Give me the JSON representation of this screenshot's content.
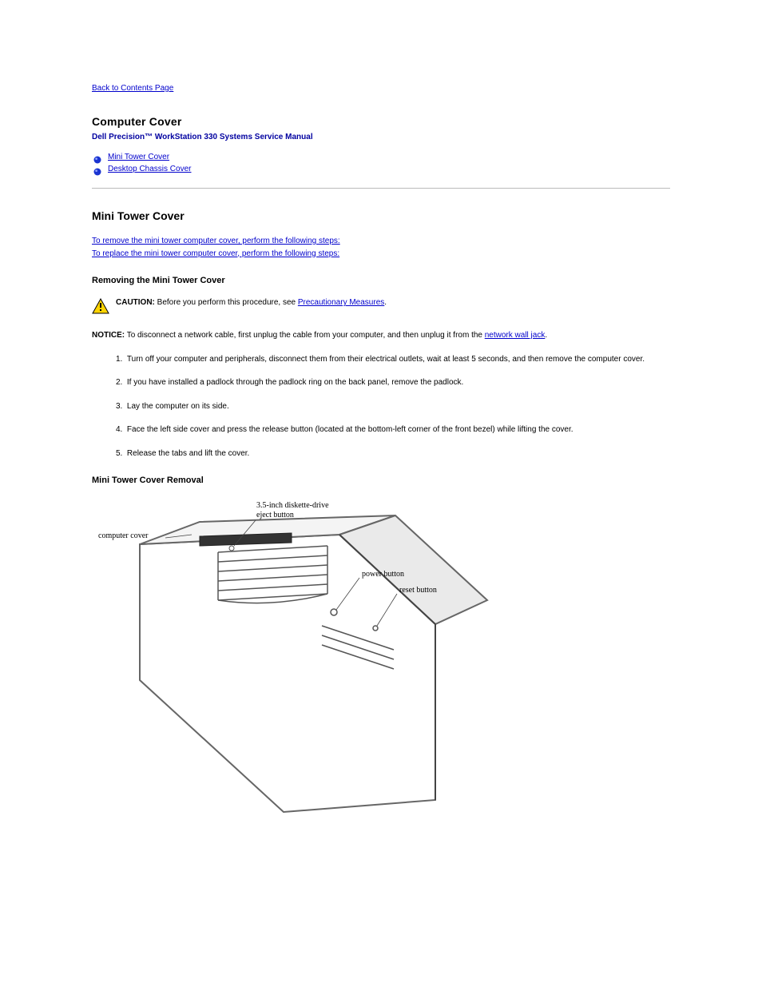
{
  "nav": {
    "back_label": "Back to Contents Page"
  },
  "title": "Computer Cover",
  "subtitle": "Dell Precision™ WorkStation 330 Systems Service Manual",
  "toc": [
    {
      "label": "Mini Tower Cover"
    },
    {
      "label": "Desktop Chassis Cover"
    }
  ],
  "section_heading": "Mini Tower Cover",
  "intro_lines": [
    "To remove the mini tower computer cover, perform the following steps:",
    "To replace the mini tower computer cover, perform the following steps:"
  ],
  "caution": {
    "label": "CAUTION:",
    "before_link": "Before you perform this procedure, see ",
    "link": "Precautionary Measures",
    "after_link": "."
  },
  "notice": {
    "label": "NOTICE:",
    "before_link": "To disconnect a network cable, first unplug the cable from your computer, and then unplug it from the ",
    "link": "network wall jack",
    "after_link": "."
  },
  "steps": [
    "Turn off your computer and peripherals, disconnect them from their electrical outlets, wait at least 5 seconds, and then remove the computer cover.",
    "If you have installed a padlock through the padlock ring on the back panel, remove the padlock.",
    "Lay the computer on its side.",
    "Face the left side cover and press the release button (located at the bottom-left corner of the front bezel) while lifting the cover.",
    "Release the tabs and lift the cover."
  ],
  "diagram": {
    "heading": "Mini Tower Cover Removal",
    "labels": {
      "computer_cover": "computer cover",
      "eject_button": "3.5-inch diskette-drive\neject button",
      "power_button": "power button",
      "reset_button": "reset button"
    }
  }
}
